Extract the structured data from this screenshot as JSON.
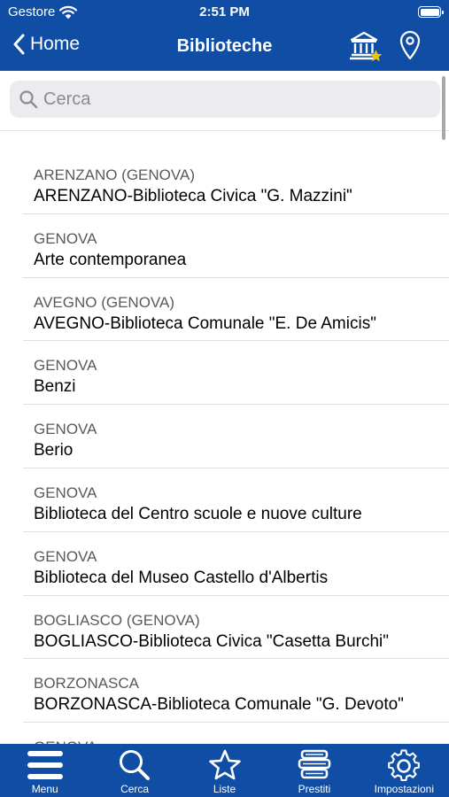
{
  "status_bar": {
    "carrier": "Gestore",
    "time": "2:51 PM"
  },
  "nav": {
    "back_label": "Home",
    "title": "Biblioteche"
  },
  "search": {
    "placeholder": "Cerca",
    "value": ""
  },
  "libraries": [
    {
      "city": "ARENZANO (GENOVA)",
      "name": "ARENZANO-Biblioteca Civica \"G. Mazzini\""
    },
    {
      "city": "GENOVA",
      "name": "Arte contemporanea"
    },
    {
      "city": "AVEGNO (GENOVA)",
      "name": "AVEGNO-Biblioteca Comunale \"E. De Amicis\""
    },
    {
      "city": "GENOVA",
      "name": "Benzi"
    },
    {
      "city": "GENOVA",
      "name": "Berio"
    },
    {
      "city": "GENOVA",
      "name": "Biblioteca del Centro scuole e nuove culture"
    },
    {
      "city": "GENOVA",
      "name": "Biblioteca del Museo Castello d'Albertis"
    },
    {
      "city": "BOGLIASCO (GENOVA)",
      "name": "BOGLIASCO-Biblioteca Civica \"Casetta Burchi\""
    },
    {
      "city": "BORZONASCA",
      "name": "BORZONASCA-Biblioteca Comunale \"G. Devoto\""
    },
    {
      "city": "GENOVA",
      "name": ""
    }
  ],
  "tabs": [
    {
      "label": "Menu",
      "icon": "menu-icon"
    },
    {
      "label": "Cerca",
      "icon": "search-icon"
    },
    {
      "label": "Liste",
      "icon": "star-icon"
    },
    {
      "label": "Prestiti",
      "icon": "books-icon"
    },
    {
      "label": "Impostazioni",
      "icon": "gear-icon"
    }
  ],
  "colors": {
    "brand": "#0f4ea4",
    "favorite": "#f5c400"
  }
}
